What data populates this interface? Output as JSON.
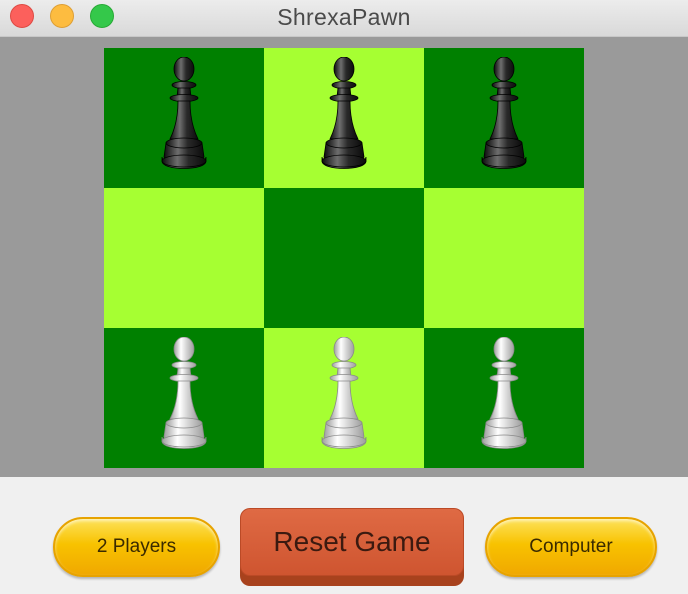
{
  "window": {
    "title": "ShrexaPawn"
  },
  "board": {
    "rows": 3,
    "cols": 3,
    "colors": {
      "dark": "#008000",
      "light": "#a6ff32"
    },
    "squares": [
      [
        {
          "color": "dark",
          "piece": "black-pawn"
        },
        {
          "color": "light",
          "piece": "black-pawn"
        },
        {
          "color": "dark",
          "piece": "black-pawn"
        }
      ],
      [
        {
          "color": "light",
          "piece": ""
        },
        {
          "color": "dark",
          "piece": ""
        },
        {
          "color": "light",
          "piece": ""
        }
      ],
      [
        {
          "color": "dark",
          "piece": "white-pawn"
        },
        {
          "color": "light",
          "piece": "white-pawn"
        },
        {
          "color": "dark",
          "piece": "white-pawn"
        }
      ]
    ]
  },
  "controls": {
    "two_players_label": "2 Players",
    "reset_label": "Reset Game",
    "computer_label": "Computer"
  }
}
